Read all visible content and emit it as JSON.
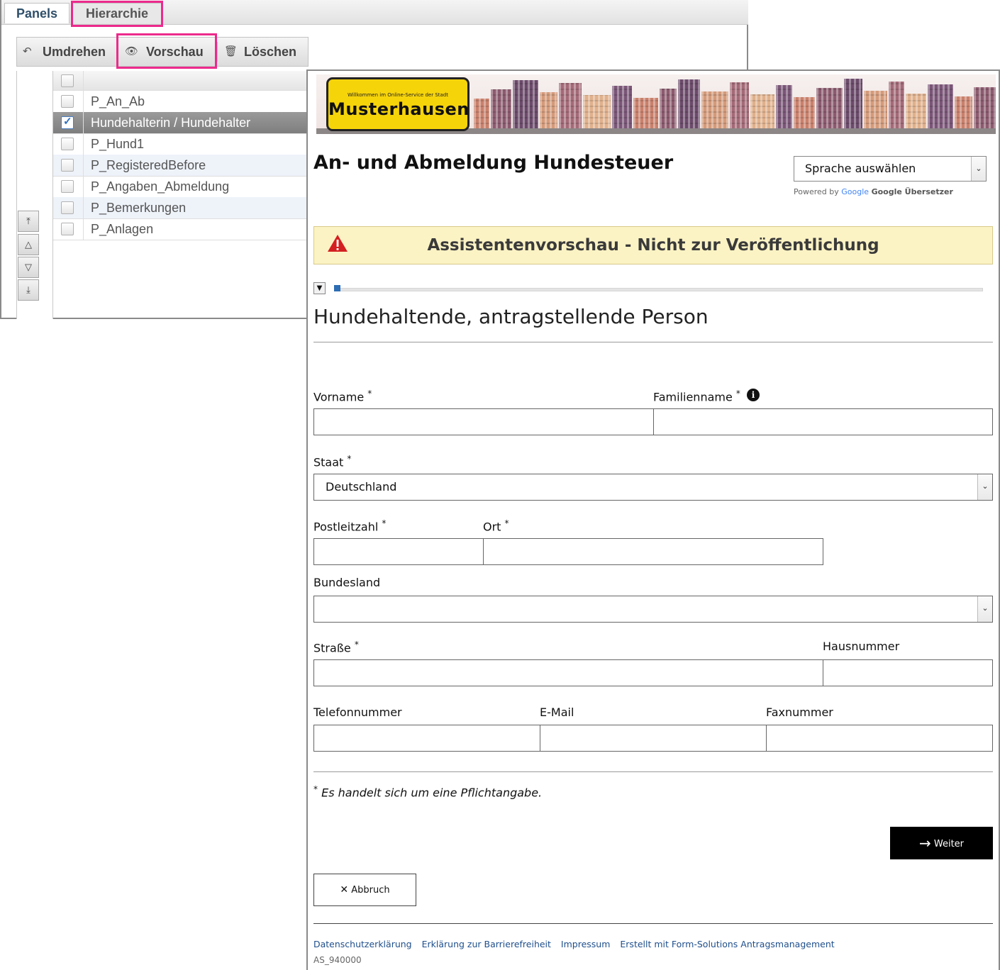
{
  "editor": {
    "tabs": [
      "Panels",
      "Hierarchie"
    ],
    "toolbar": {
      "reverse_label": "Umdrehen",
      "preview_label": "Vorschau",
      "delete_label": "Löschen"
    },
    "rows": [
      {
        "label": "P_An_Ab",
        "checked": false
      },
      {
        "label": "Hundehalterin / Hundehalter",
        "checked": true
      },
      {
        "label": "P_Hund1",
        "checked": false
      },
      {
        "label": "P_RegisteredBefore",
        "checked": false
      },
      {
        "label": "P_Angaben_Abmeldung",
        "checked": false
      },
      {
        "label": "P_Bemerkungen",
        "checked": false
      },
      {
        "label": "P_Anlagen",
        "checked": false
      }
    ]
  },
  "preview": {
    "banner": {
      "sign_small": "Willkommen im Online-Service der Stadt",
      "sign_big": "Musterhausen"
    },
    "title": "An- und Abmeldung Hundesteuer",
    "language_select": "Sprache auswählen",
    "powered": {
      "prefix": "Powered by",
      "google": "Google",
      "suffix": "Google Übersetzer"
    },
    "warning": "Assistentenvorschau - Nicht zur Veröffentlichung",
    "section_title": "Hundehaltende, antragstellende Person",
    "fields": {
      "vorname": "Vorname",
      "familienname": "Familienname",
      "staat": "Staat",
      "staat_value": "Deutschland",
      "postleitzahl": "Postleitzahl",
      "ort": "Ort",
      "bundesland": "Bundesland",
      "strasse": "Straße",
      "hausnummer": "Hausnummer",
      "telefon": "Telefonnummer",
      "email": "E-Mail",
      "fax": "Faxnummer"
    },
    "required_mark": "*",
    "required_note": "Es handelt sich um eine Pflichtangabe.",
    "next_label": "Weiter",
    "cancel_label": "Abbruch",
    "footer_links": [
      "Datenschutzerklärung",
      "Erklärung zur Barrierefreiheit",
      "Impressum",
      "Erstellt mit Form-Solutions Antragsmanagement"
    ],
    "form_id": "AS_940000"
  },
  "colors": {
    "highlight": "#ec2a8c",
    "warning_bg": "#fcf3c4",
    "sign_yellow": "#f6d40a",
    "link": "#1f4f8c"
  }
}
